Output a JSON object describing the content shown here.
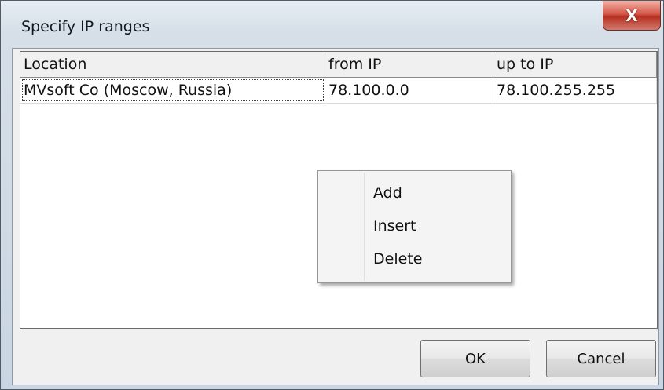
{
  "window": {
    "title": "Specify IP ranges",
    "close_glyph": "X"
  },
  "table": {
    "columns": [
      "Location",
      "from IP",
      "up to IP"
    ],
    "rows": [
      [
        "MVsoft Co (Moscow, Russia)",
        "78.100.0.0",
        "78.100.255.255"
      ]
    ]
  },
  "context_menu": {
    "items": [
      "Add",
      "Insert",
      "Delete"
    ]
  },
  "buttons": {
    "ok": "OK",
    "cancel": "Cancel"
  }
}
